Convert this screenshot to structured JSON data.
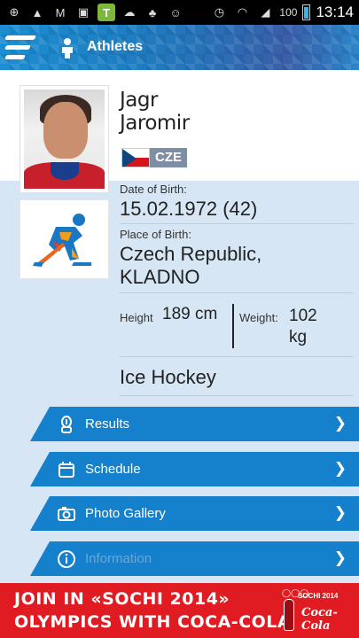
{
  "status_bar": {
    "battery": "100",
    "time": "13:14"
  },
  "header": {
    "title": "Athletes"
  },
  "athlete": {
    "last_name": "Jagr",
    "first_name": "Jaromir",
    "country_code": "CZE",
    "dob_label": "Date of Birth:",
    "dob_value": "15.02.1972 (42)",
    "pob_label": "Place of Birth:",
    "pob_line1": "Czech Republic,",
    "pob_line2": "KLADNO",
    "height_label": "Height",
    "height_value": "189 cm",
    "weight_label": "Weight:",
    "weight_value_1": "102",
    "weight_value_2": "kg",
    "sport": "Ice Hockey"
  },
  "nav": {
    "results": "Results",
    "schedule": "Schedule",
    "photo_gallery": "Photo Gallery",
    "information": "Information",
    "chevron": "❯"
  },
  "ad": {
    "line1": "JOIN IN «SOCHI 2014»",
    "line2": "OLYMPICS WITH COCA-COLA",
    "event": "SOCHI 2014",
    "brand": "Coca-Cola"
  },
  "colors": {
    "nav_button": "#1580cc",
    "info_background": "#d6e6f4",
    "ad_background": "#e11b22"
  }
}
